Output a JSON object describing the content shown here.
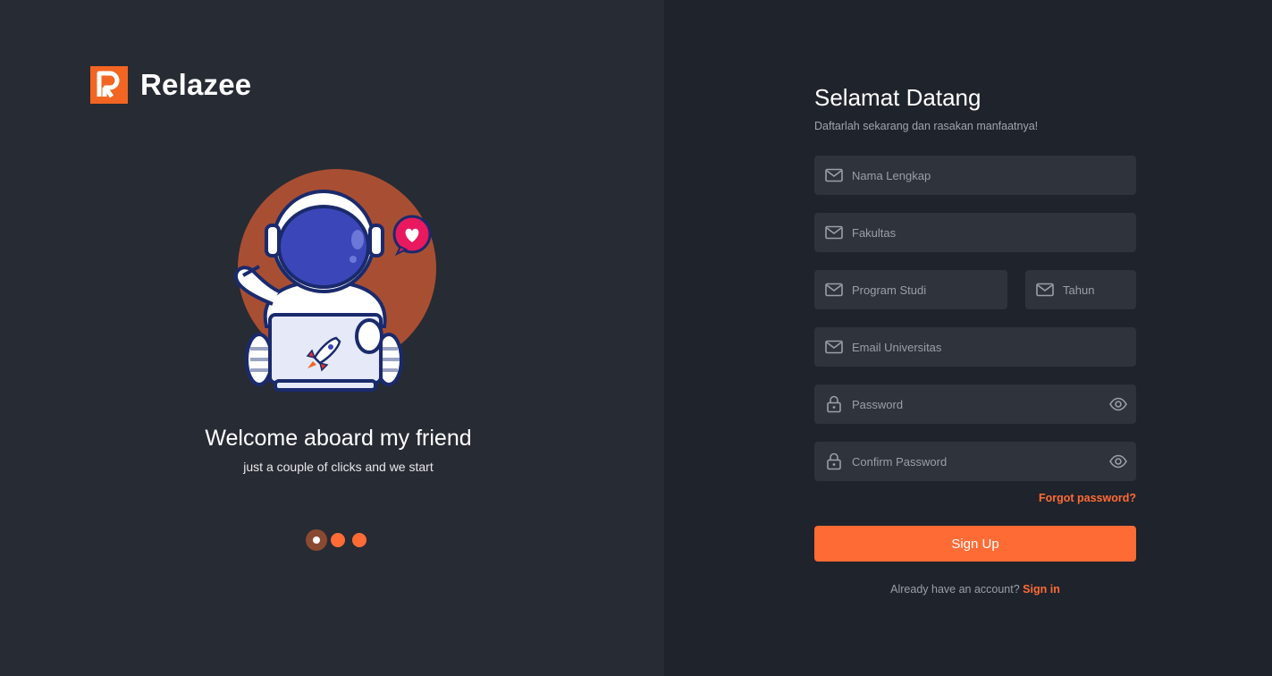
{
  "brand": {
    "name": "Relazee",
    "accent": "#ff6b35"
  },
  "welcome": {
    "title": "Welcome aboard my friend",
    "subtitle": "just a couple of clicks and we start"
  },
  "carousel": {
    "count": 3,
    "active": 1
  },
  "form": {
    "title": "Selamat Datang",
    "subtitle": "Daftarlah sekarang dan rasakan manfaatnya!",
    "fields": {
      "full_name": {
        "placeholder": "Nama Lengkap",
        "icon": "mail-icon"
      },
      "faculty": {
        "placeholder": "Fakultas",
        "icon": "mail-icon"
      },
      "study_program": {
        "placeholder": "Program Studi",
        "icon": "mail-icon"
      },
      "year": {
        "placeholder": "Tahun",
        "icon": "mail-icon"
      },
      "email": {
        "placeholder": "Email Universitas",
        "icon": "mail-icon"
      },
      "password": {
        "placeholder": "Password",
        "icon": "lock-icon"
      },
      "confirm_password": {
        "placeholder": "Confirm Password",
        "icon": "lock-icon"
      }
    },
    "forgot_label": "Forgot password?",
    "submit_label": "Sign Up",
    "have_account_text": "Already have an account?",
    "signin_label": "Sign in"
  }
}
